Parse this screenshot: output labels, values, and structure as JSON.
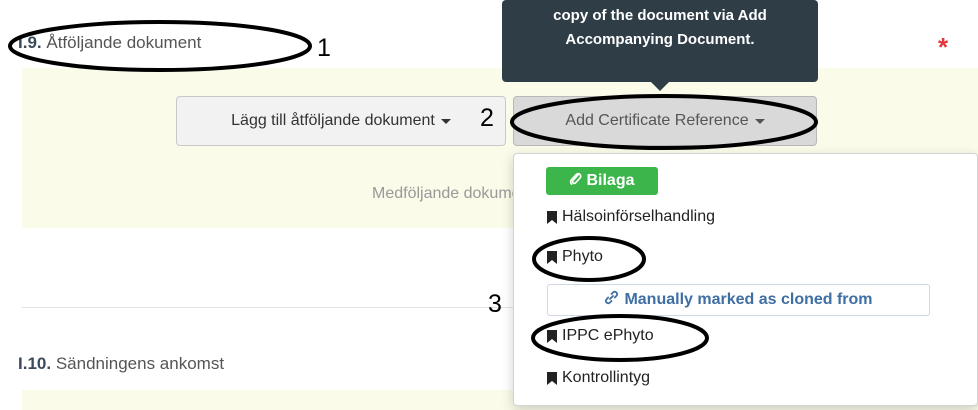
{
  "section_19": {
    "number": "I.9.",
    "title": "Åtföljande dokument",
    "required_marker": "*"
  },
  "section_110": {
    "number": "I.10.",
    "title": "Sändningens ankomst"
  },
  "buttons": {
    "add_document": "Lägg till åtföljande dokument",
    "add_certificate_reference": "Add Certificate Reference"
  },
  "empty_text": "Medföljande dokument",
  "tooltip": {
    "line1": "copy of the document via Add",
    "line2": "Accompanying Document."
  },
  "dropdown": {
    "tag": "Bilaga",
    "items": [
      "Hälsoinförselhandling",
      "Phyto",
      "IPPC ePhyto",
      "Kontrollintyg"
    ],
    "cloned_button": "Manually marked as cloned from"
  },
  "annotations": [
    "1",
    "2",
    "3"
  ],
  "colors": {
    "tag_green": "#3cb54a",
    "link_blue": "#3f6ea3",
    "tooltip_bg": "#2f3d46",
    "panel_yellow": "#fbfbe9",
    "star_red": "#e0383e"
  },
  "icons": [
    "paperclip-icon",
    "bookmark-icon",
    "link-icon",
    "caret-down-icon"
  ]
}
